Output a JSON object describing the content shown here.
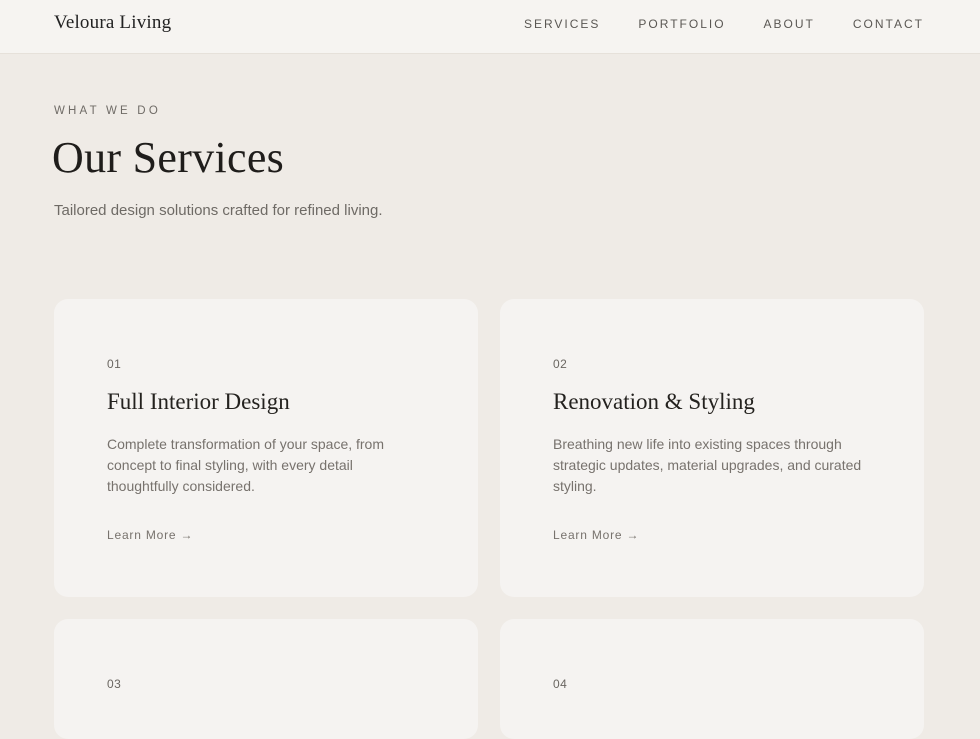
{
  "header": {
    "brand": "Veloura Living",
    "nav": [
      "SERVICES",
      "PORTFOLIO",
      "ABOUT",
      "CONTACT"
    ]
  },
  "hero": {
    "eyebrow": "WHAT WE DO",
    "title": "Our Services",
    "subtitle": "Tailored design solutions crafted for refined living."
  },
  "services": [
    {
      "number": "01",
      "title": "Full Interior Design",
      "description": "Complete transformation of your space, from concept to final styling, with every detail thoughtfully considered.",
      "link": "Learn More →"
    },
    {
      "number": "02",
      "title": "Renovation & Styling",
      "description": "Breathing new life into existing spaces through strategic updates, material upgrades, and curated styling.",
      "link": "Learn More →"
    },
    {
      "number": "03"
    },
    {
      "number": "04"
    }
  ]
}
